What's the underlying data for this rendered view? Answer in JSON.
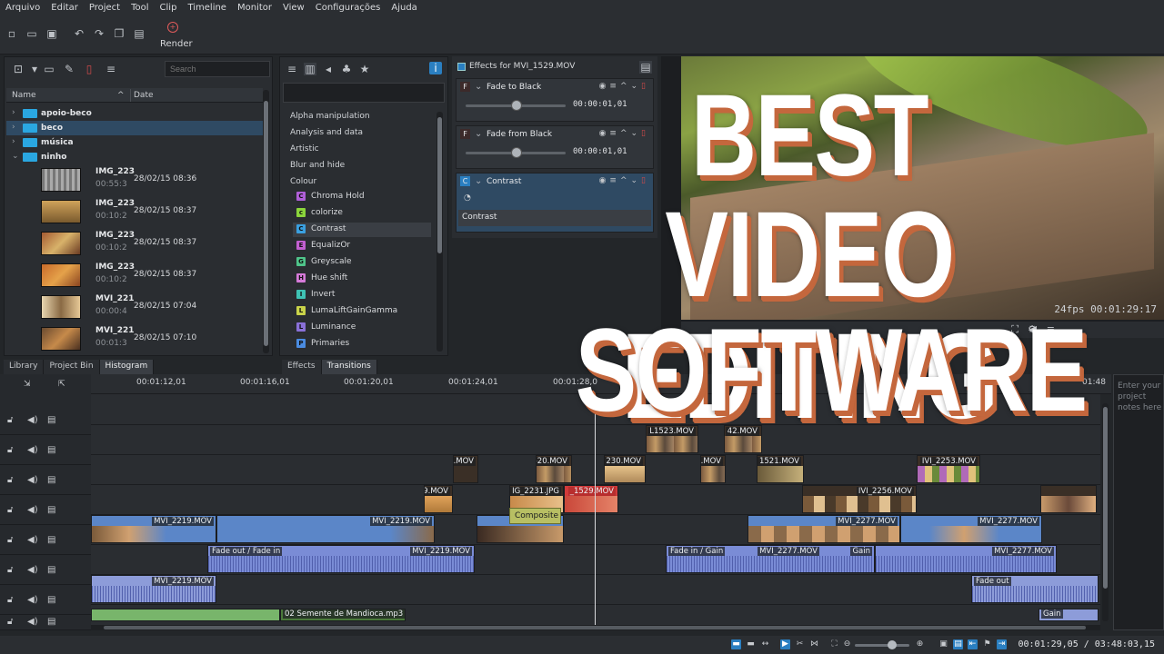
{
  "menu": [
    "Arquivo",
    "Editar",
    "Project",
    "Tool",
    "Clip",
    "Timeline",
    "Monitor",
    "View",
    "Configurações",
    "Ajuda"
  ],
  "toolbar": {
    "render_label": "Render"
  },
  "bin": {
    "search_placeholder": "Search",
    "col_name": "Name",
    "col_date": "Date",
    "folders": [
      {
        "name": "apoio-beco"
      },
      {
        "name": "beco"
      },
      {
        "name": "música"
      },
      {
        "name": "ninho"
      }
    ],
    "clips": [
      {
        "name": "IMG_223",
        "dur": "00:55:3",
        "date": "28/02/15 08:36"
      },
      {
        "name": "IMG_223",
        "dur": "00:10:2",
        "date": "28/02/15 08:37"
      },
      {
        "name": "IMG_223",
        "dur": "00:10:2",
        "date": "28/02/15 08:37"
      },
      {
        "name": "IMG_223",
        "dur": "00:10:2",
        "date": "28/02/15 08:37"
      },
      {
        "name": "MVI_221",
        "dur": "00:00:4",
        "date": "28/02/15 07:04"
      },
      {
        "name": "MVI_221",
        "dur": "00:01:3",
        "date": "28/02/15 07:10"
      }
    ],
    "tabs": [
      "Library",
      "Project Bin",
      "Histogram"
    ]
  },
  "effects": {
    "categories": [
      "Alpha manipulation",
      "Analysis and data",
      "Artistic",
      "Blur and hide",
      "Colour"
    ],
    "items": [
      {
        "badge": "C",
        "color": "#b05fd8",
        "name": "Chroma Hold"
      },
      {
        "badge": "c",
        "color": "#8bd53c",
        "name": "colorize"
      },
      {
        "badge": "C",
        "color": "#3aa0e0",
        "name": "Contrast"
      },
      {
        "badge": "E",
        "color": "#c25fd0",
        "name": "EqualizOr"
      },
      {
        "badge": "G",
        "color": "#4fc48a",
        "name": "Greyscale"
      },
      {
        "badge": "H",
        "color": "#d57ad8",
        "name": "Hue shift"
      },
      {
        "badge": "I",
        "color": "#3fc2b4",
        "name": "Invert"
      },
      {
        "badge": "L",
        "color": "#c9d34a",
        "name": "LumaLiftGainGamma"
      },
      {
        "badge": "L",
        "color": "#8a70d8",
        "name": "Luminance"
      },
      {
        "badge": "P",
        "color": "#4a8be0",
        "name": "Primaries"
      }
    ],
    "tabs": [
      "Effects",
      "Transitions"
    ]
  },
  "stack": {
    "title": "Effects for MVI_1529.MOV",
    "effects": [
      {
        "badge": "F",
        "name": "Fade to Black",
        "time": "00:00:01,01"
      },
      {
        "badge": "F",
        "name": "Fade from Black",
        "time": "00:00:01,01"
      },
      {
        "badge": "C",
        "name": "Contrast",
        "param": "Contrast"
      }
    ]
  },
  "monitor": {
    "fps": "24fps 00:01:29:17"
  },
  "notes": {
    "placeholder": "Enter your project notes here"
  },
  "ruler": [
    "00:01:12,01",
    "00:01:16,01",
    "00:01:20,01",
    "00:01:24,01",
    "00:01:28,0",
    "01:48"
  ],
  "clips": {
    "c1": "L1523.MOV",
    "c2": "42.MOV",
    "c3": ".MOV",
    "c4": "-20.MOV",
    "c5": "230.MOV",
    "c6": ".MOV",
    "c7": "1521.MOV",
    "c8": "IVI_2253.MOV",
    "c9": "9.MOV",
    "c10": "IG_2231.JPG",
    "c11": "_1529.MOV",
    "c12": "IVI_2256.MOV",
    "c13": "MVI_2219.MOV",
    "c14": "MVI_2219.MOV",
    "c15": "MVI_2277.MOV",
    "c16": "MVI_2277.MOV",
    "c17": "Fade out / Fade in",
    "c18": "MVI_2219.MOV",
    "c19": "Fade in / Gain",
    "c20": "MVI_2277.MOV",
    "c21": "Gain",
    "c22": "MVI_2277.MOV",
    "c23": "MVI_2219.MOV",
    "c24": "Fade out",
    "c25": "02 Semente de Mandioca.mp3",
    "c26": "Gain"
  },
  "composite_label": "Composite",
  "timecode": "00:01:29,05 / 03:48:03,15",
  "headline": {
    "line1": "BEST",
    "line2": "VIDEO EDITING",
    "line3": "SOFTWARE"
  }
}
